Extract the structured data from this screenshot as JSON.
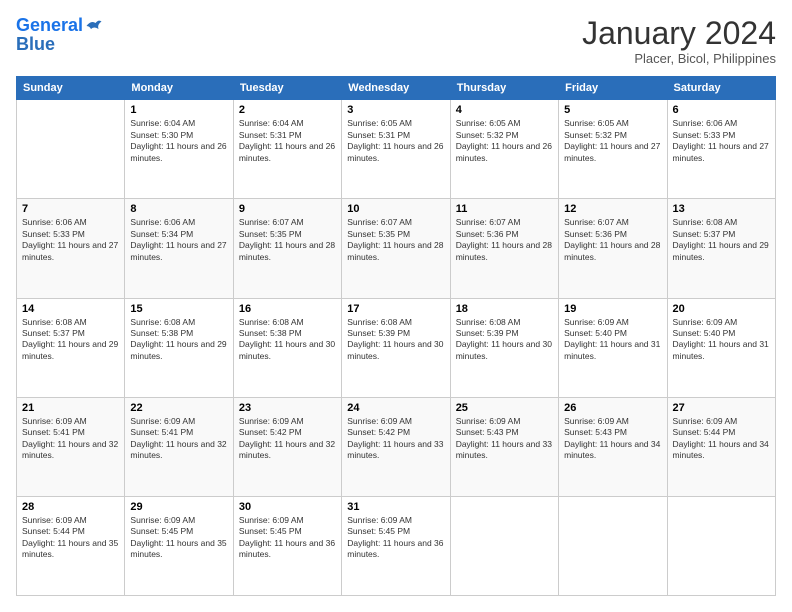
{
  "header": {
    "logo_line1": "General",
    "logo_line2": "Blue",
    "month_title": "January 2024",
    "subtitle": "Placer, Bicol, Philippines"
  },
  "days_of_week": [
    "Sunday",
    "Monday",
    "Tuesday",
    "Wednesday",
    "Thursday",
    "Friday",
    "Saturday"
  ],
  "weeks": [
    [
      {
        "day": "",
        "sunrise": "",
        "sunset": "",
        "daylight": ""
      },
      {
        "day": "1",
        "sunrise": "Sunrise: 6:04 AM",
        "sunset": "Sunset: 5:30 PM",
        "daylight": "Daylight: 11 hours and 26 minutes."
      },
      {
        "day": "2",
        "sunrise": "Sunrise: 6:04 AM",
        "sunset": "Sunset: 5:31 PM",
        "daylight": "Daylight: 11 hours and 26 minutes."
      },
      {
        "day": "3",
        "sunrise": "Sunrise: 6:05 AM",
        "sunset": "Sunset: 5:31 PM",
        "daylight": "Daylight: 11 hours and 26 minutes."
      },
      {
        "day": "4",
        "sunrise": "Sunrise: 6:05 AM",
        "sunset": "Sunset: 5:32 PM",
        "daylight": "Daylight: 11 hours and 26 minutes."
      },
      {
        "day": "5",
        "sunrise": "Sunrise: 6:05 AM",
        "sunset": "Sunset: 5:32 PM",
        "daylight": "Daylight: 11 hours and 27 minutes."
      },
      {
        "day": "6",
        "sunrise": "Sunrise: 6:06 AM",
        "sunset": "Sunset: 5:33 PM",
        "daylight": "Daylight: 11 hours and 27 minutes."
      }
    ],
    [
      {
        "day": "7",
        "sunrise": "Sunrise: 6:06 AM",
        "sunset": "Sunset: 5:33 PM",
        "daylight": "Daylight: 11 hours and 27 minutes."
      },
      {
        "day": "8",
        "sunrise": "Sunrise: 6:06 AM",
        "sunset": "Sunset: 5:34 PM",
        "daylight": "Daylight: 11 hours and 27 minutes."
      },
      {
        "day": "9",
        "sunrise": "Sunrise: 6:07 AM",
        "sunset": "Sunset: 5:35 PM",
        "daylight": "Daylight: 11 hours and 28 minutes."
      },
      {
        "day": "10",
        "sunrise": "Sunrise: 6:07 AM",
        "sunset": "Sunset: 5:35 PM",
        "daylight": "Daylight: 11 hours and 28 minutes."
      },
      {
        "day": "11",
        "sunrise": "Sunrise: 6:07 AM",
        "sunset": "Sunset: 5:36 PM",
        "daylight": "Daylight: 11 hours and 28 minutes."
      },
      {
        "day": "12",
        "sunrise": "Sunrise: 6:07 AM",
        "sunset": "Sunset: 5:36 PM",
        "daylight": "Daylight: 11 hours and 28 minutes."
      },
      {
        "day": "13",
        "sunrise": "Sunrise: 6:08 AM",
        "sunset": "Sunset: 5:37 PM",
        "daylight": "Daylight: 11 hours and 29 minutes."
      }
    ],
    [
      {
        "day": "14",
        "sunrise": "Sunrise: 6:08 AM",
        "sunset": "Sunset: 5:37 PM",
        "daylight": "Daylight: 11 hours and 29 minutes."
      },
      {
        "day": "15",
        "sunrise": "Sunrise: 6:08 AM",
        "sunset": "Sunset: 5:38 PM",
        "daylight": "Daylight: 11 hours and 29 minutes."
      },
      {
        "day": "16",
        "sunrise": "Sunrise: 6:08 AM",
        "sunset": "Sunset: 5:38 PM",
        "daylight": "Daylight: 11 hours and 30 minutes."
      },
      {
        "day": "17",
        "sunrise": "Sunrise: 6:08 AM",
        "sunset": "Sunset: 5:39 PM",
        "daylight": "Daylight: 11 hours and 30 minutes."
      },
      {
        "day": "18",
        "sunrise": "Sunrise: 6:08 AM",
        "sunset": "Sunset: 5:39 PM",
        "daylight": "Daylight: 11 hours and 30 minutes."
      },
      {
        "day": "19",
        "sunrise": "Sunrise: 6:09 AM",
        "sunset": "Sunset: 5:40 PM",
        "daylight": "Daylight: 11 hours and 31 minutes."
      },
      {
        "day": "20",
        "sunrise": "Sunrise: 6:09 AM",
        "sunset": "Sunset: 5:40 PM",
        "daylight": "Daylight: 11 hours and 31 minutes."
      }
    ],
    [
      {
        "day": "21",
        "sunrise": "Sunrise: 6:09 AM",
        "sunset": "Sunset: 5:41 PM",
        "daylight": "Daylight: 11 hours and 32 minutes."
      },
      {
        "day": "22",
        "sunrise": "Sunrise: 6:09 AM",
        "sunset": "Sunset: 5:41 PM",
        "daylight": "Daylight: 11 hours and 32 minutes."
      },
      {
        "day": "23",
        "sunrise": "Sunrise: 6:09 AM",
        "sunset": "Sunset: 5:42 PM",
        "daylight": "Daylight: 11 hours and 32 minutes."
      },
      {
        "day": "24",
        "sunrise": "Sunrise: 6:09 AM",
        "sunset": "Sunset: 5:42 PM",
        "daylight": "Daylight: 11 hours and 33 minutes."
      },
      {
        "day": "25",
        "sunrise": "Sunrise: 6:09 AM",
        "sunset": "Sunset: 5:43 PM",
        "daylight": "Daylight: 11 hours and 33 minutes."
      },
      {
        "day": "26",
        "sunrise": "Sunrise: 6:09 AM",
        "sunset": "Sunset: 5:43 PM",
        "daylight": "Daylight: 11 hours and 34 minutes."
      },
      {
        "day": "27",
        "sunrise": "Sunrise: 6:09 AM",
        "sunset": "Sunset: 5:44 PM",
        "daylight": "Daylight: 11 hours and 34 minutes."
      }
    ],
    [
      {
        "day": "28",
        "sunrise": "Sunrise: 6:09 AM",
        "sunset": "Sunset: 5:44 PM",
        "daylight": "Daylight: 11 hours and 35 minutes."
      },
      {
        "day": "29",
        "sunrise": "Sunrise: 6:09 AM",
        "sunset": "Sunset: 5:45 PM",
        "daylight": "Daylight: 11 hours and 35 minutes."
      },
      {
        "day": "30",
        "sunrise": "Sunrise: 6:09 AM",
        "sunset": "Sunset: 5:45 PM",
        "daylight": "Daylight: 11 hours and 36 minutes."
      },
      {
        "day": "31",
        "sunrise": "Sunrise: 6:09 AM",
        "sunset": "Sunset: 5:45 PM",
        "daylight": "Daylight: 11 hours and 36 minutes."
      },
      {
        "day": "",
        "sunrise": "",
        "sunset": "",
        "daylight": ""
      },
      {
        "day": "",
        "sunrise": "",
        "sunset": "",
        "daylight": ""
      },
      {
        "day": "",
        "sunrise": "",
        "sunset": "",
        "daylight": ""
      }
    ]
  ]
}
